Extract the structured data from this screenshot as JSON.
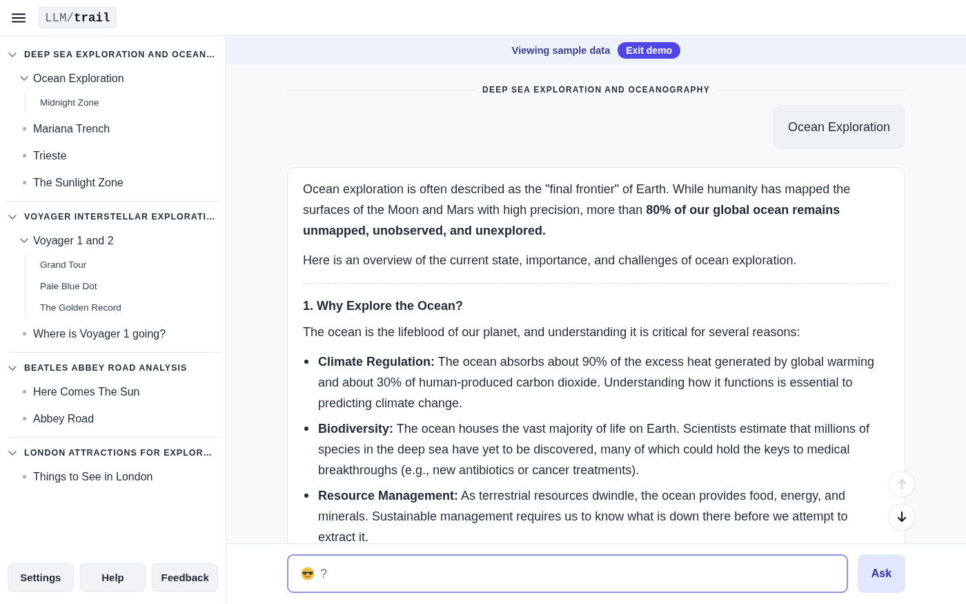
{
  "topbar": {
    "logo": "LLM/**trail**"
  },
  "sidebar": {
    "sections": [
      {
        "title": "DEEP SEA EXPLORATION AND OCEAN…",
        "expanded": true,
        "items": [
          {
            "label": "Ocean Exploration",
            "expanded": true,
            "children": [
              {
                "label": "Midnight Zone"
              }
            ]
          },
          {
            "label": "Mariana Trench"
          },
          {
            "label": "Trieste"
          },
          {
            "label": "The Sunlight Zone"
          }
        ]
      },
      {
        "title": "VOYAGER INTERSTELLAR EXPLORATI…",
        "expanded": true,
        "items": [
          {
            "label": "Voyager 1 and 2",
            "expanded": true,
            "children": [
              {
                "label": "Grand Tour"
              },
              {
                "label": "Pale Blue Dot"
              },
              {
                "label": "The Golden Record"
              }
            ]
          },
          {
            "label": "Where is Voyager 1 going?"
          }
        ]
      },
      {
        "title": "BEATLES ABBEY ROAD ANALYSIS",
        "expanded": true,
        "items": [
          {
            "label": "Here Comes The Sun"
          },
          {
            "label": "Abbey Road"
          }
        ]
      },
      {
        "title": "LONDON ATTRACTIONS FOR EXPLOR…",
        "expanded": true,
        "items": [
          {
            "label": "Things to See in London"
          }
        ]
      }
    ],
    "buttons": [
      "Settings",
      "Help",
      "Feedback"
    ]
  },
  "banner": {
    "text": "Viewing sample data",
    "button": "Exit demo"
  },
  "conversation": {
    "topic": "DEEP SEA EXPLORATION AND OCEANOGRAPHY",
    "question": "Ocean Exploration",
    "answer": [
      {
        "kind": "paragraph",
        "text": "Ocean exploration is often described as the \"final frontier\" of Earth. While humanity has mapped the surfaces of the Moon and Mars with high precision, more than **80% of our global ocean remains unmapped, unobserved, and unexplored.**"
      },
      {
        "kind": "paragraph",
        "text": "Here is an overview of the current state, importance, and challenges of ocean exploration."
      },
      {
        "kind": "rule"
      },
      {
        "kind": "heading",
        "text": "1. Why Explore the Ocean?"
      },
      {
        "kind": "paragraph",
        "text": "The ocean is the lifeblood of our planet, and understanding it is critical for several reasons:"
      },
      {
        "kind": "list",
        "items": [
          "**Climate Regulation:** The ocean absorbs about 90% of the excess heat generated by global warming and about 30% of human-produced carbon dioxide. Understanding how it functions is essential to predicting climate change.",
          "**Biodiversity:** The ocean houses the vast majority of life on Earth. Scientists estimate that millions of species in the deep sea have yet to be discovered, many of which could hold the keys to medical breakthroughs (e.g., new antibiotics or cancer treatments).",
          "**Resource Management:** As terrestrial resources dwindle, the ocean provides food, energy, and minerals. Sustainable management requires us to know what is down there before we attempt to extract it."
        ]
      }
    ]
  },
  "scroll_buttons": [
    {
      "kind": "up",
      "disabled": true
    },
    {
      "kind": "down",
      "disabled": false
    }
  ],
  "composer": {
    "placeholder": "?",
    "button": "Ask"
  }
}
